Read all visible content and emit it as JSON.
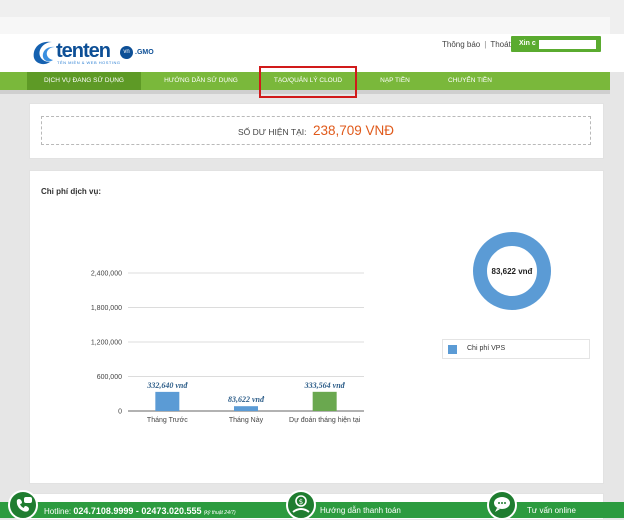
{
  "header": {
    "logo_text": "tenten",
    "logo_badge": "vn",
    "logo_gmo": ".GMO",
    "logo_tagline": "TÊN MIỀN & WEB HOSTING",
    "notifications_label": "Thông báo",
    "logout_label": "Thoát",
    "greeting_label": "Xin c"
  },
  "nav": {
    "items": [
      {
        "label": "Dịch vụ đang sử dụng",
        "active": true
      },
      {
        "label": "Hướng dẫn sử dụng",
        "active": false
      },
      {
        "label": "Tạo/Quản lý Cloud",
        "active": false
      },
      {
        "label": "Nạp tiền",
        "active": false
      },
      {
        "label": "Chuyển tiền",
        "active": false
      }
    ]
  },
  "balance": {
    "label": "Số dư hiện tại:",
    "value": "238,709 VNĐ"
  },
  "service_cost": {
    "title": "Chi phí dịch vụ:",
    "legend_label": "Chi phí VPS"
  },
  "chart_data": [
    {
      "type": "bar",
      "categories": [
        "Tháng Trước",
        "Tháng Này",
        "Dự đoán tháng hiện tại"
      ],
      "values": [
        332640,
        83622,
        333564
      ],
      "data_labels": [
        "332,640 vnđ",
        "83,622 vnđ",
        "333,564 vnđ"
      ],
      "bar_colors": [
        "#5b9bd5",
        "#5b9bd5",
        "#6aa84f"
      ],
      "ylim": [
        0,
        2400000
      ],
      "yticks": [
        0,
        600000,
        1200000,
        1800000,
        2400000
      ],
      "ytick_labels": [
        "0",
        "600,000",
        "1,200,000",
        "1,800,000",
        "2,400,000"
      ],
      "grid": true
    },
    {
      "type": "pie",
      "style": "donut",
      "slices": [
        {
          "label": "Chi phí VPS",
          "value": 83622
        }
      ],
      "center_label": "83,622 vnđ",
      "colors": [
        "#5b9bd5"
      ]
    }
  ],
  "footer": {
    "hotline_label": "Hotline:",
    "hotline_numbers": "024.7108.9999 - 02473.020.555",
    "hotline_note": "(kỹ thuật 24/7)",
    "payment_label": "Hướng dẫn thanh toán",
    "support_label": "Tư vấn online"
  },
  "colors": {
    "nav_green": "#7ab83b",
    "nav_active": "#5e9a26",
    "footer_green": "#2c9b3f",
    "balance_orange": "#e05a1b",
    "bar_blue": "#5b9bd5",
    "bar_green": "#6aa84f",
    "highlight_red": "#d11a1a"
  }
}
